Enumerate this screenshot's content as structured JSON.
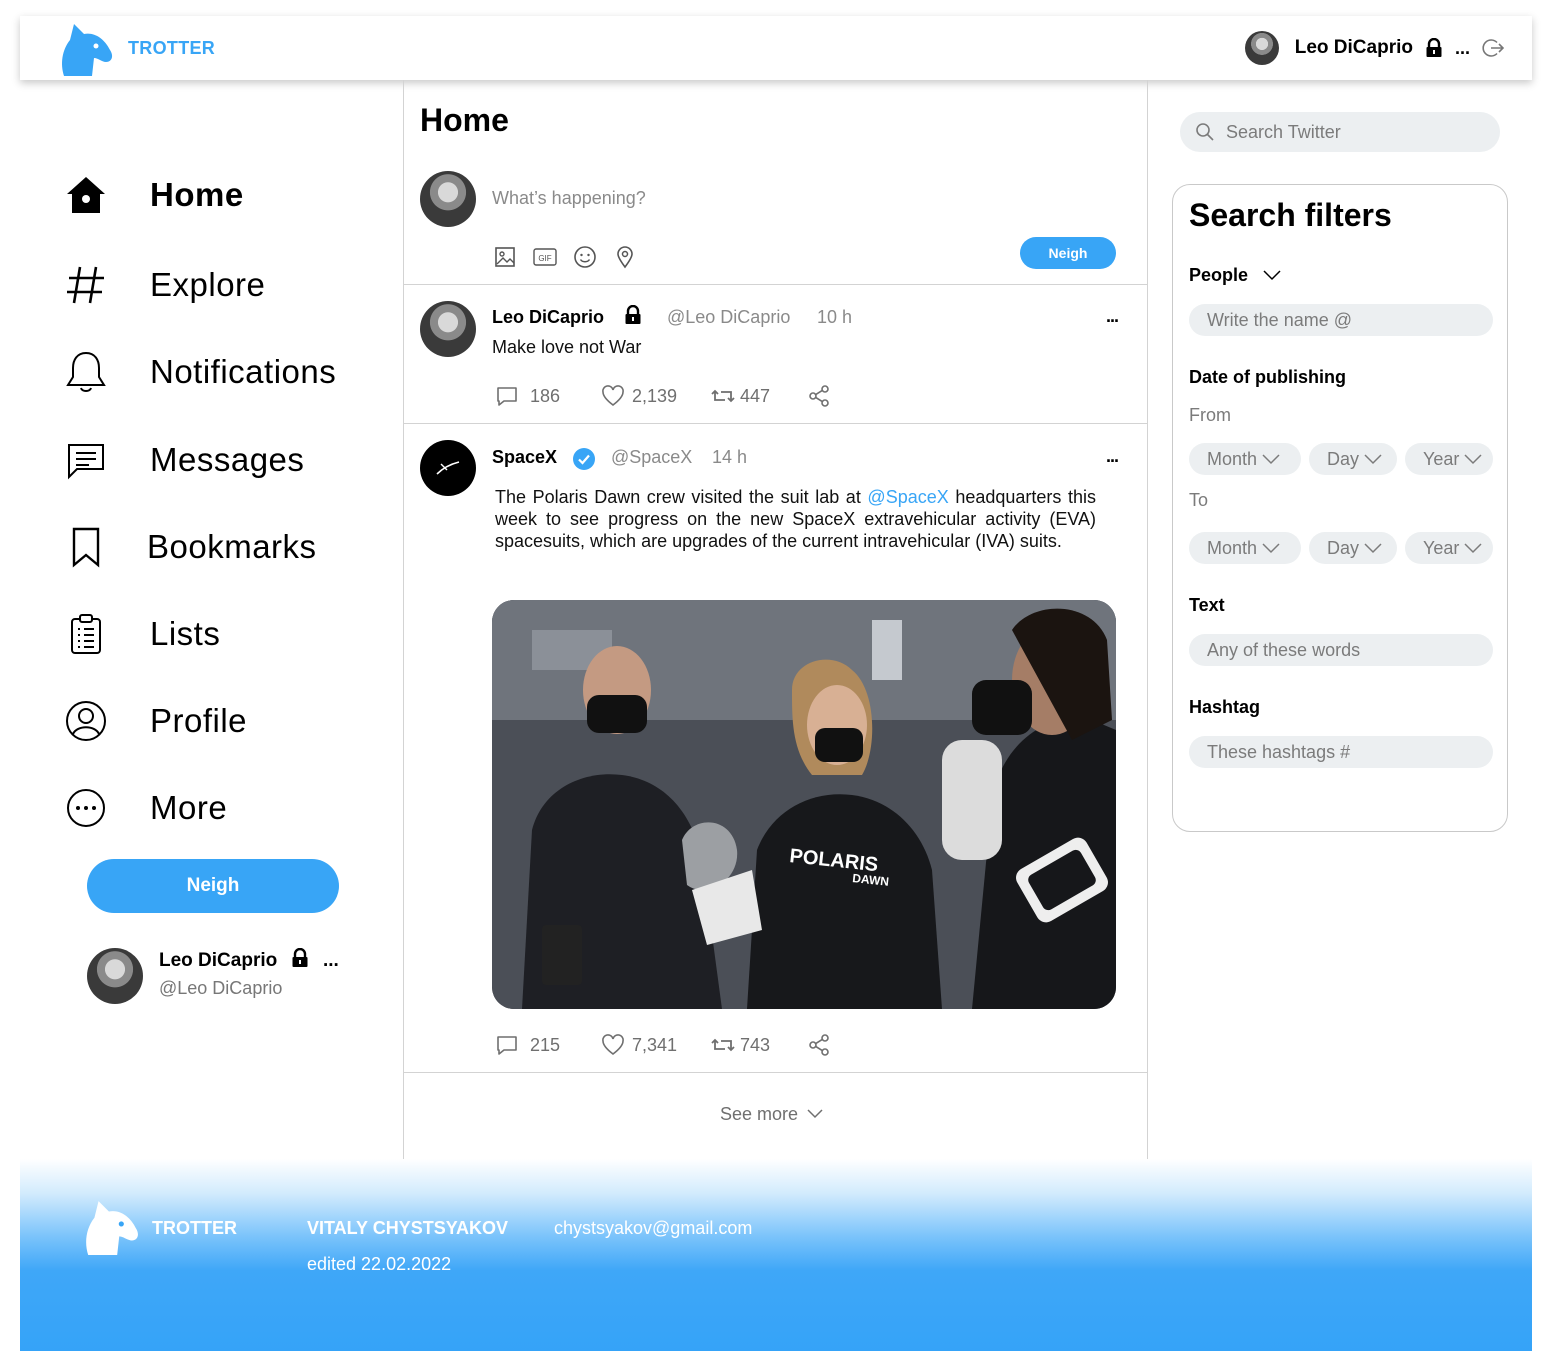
{
  "app": {
    "name": "TROTTER",
    "accent": "#38a5f6"
  },
  "header": {
    "user_name": "Leo DiCaprio",
    "more": "..."
  },
  "nav": {
    "items": [
      {
        "label": "Home",
        "icon": "home-icon"
      },
      {
        "label": "Explore",
        "icon": "hashtag-icon"
      },
      {
        "label": "Notifications",
        "icon": "bell-icon"
      },
      {
        "label": "Messages",
        "icon": "message-icon"
      },
      {
        "label": "Bookmarks",
        "icon": "bookmark-icon"
      },
      {
        "label": "Lists",
        "icon": "clipboard-icon"
      },
      {
        "label": "Profile",
        "icon": "profile-icon"
      },
      {
        "label": "More",
        "icon": "more-circle-icon"
      }
    ],
    "neigh_label": "Neigh",
    "user": {
      "name": "Leo DiCaprio",
      "handle": "@Leo DiCaprio",
      "more": "..."
    }
  },
  "main": {
    "title": "Home",
    "compose": {
      "placeholder": "What’s happening?",
      "button": "Neigh",
      "tools": [
        "image-icon",
        "gif-icon",
        "emoji-icon",
        "location-icon"
      ]
    },
    "tweets": [
      {
        "name": "Leo DiCaprio",
        "handle": "@Leo DiCaprio",
        "time": "10 h",
        "more": "...",
        "text": "Make love not War",
        "replies": "186",
        "likes": "2,139",
        "retweets": "447"
      },
      {
        "name": "SpaceX",
        "handle": "@SpaceX",
        "time": "14 h",
        "more": "...",
        "text_before": "The Polaris Dawn crew visited the suit lab at ",
        "mention": "@SpaceX",
        "text_after": " headquarters this week to see progress on the new SpaceX extravehicular activity (EVA) spacesuits, which are upgrades of the current intravehicular (IVA) suits.",
        "photo_text_1": "POLARIS",
        "photo_text_2": "DAWN",
        "replies": "215",
        "likes": "7,341",
        "retweets": "743"
      }
    ],
    "see_more": "See more"
  },
  "right": {
    "search_placeholder": "Search Twitter",
    "filters": {
      "title": "Search filters",
      "people_label": "People",
      "people_placeholder": "Write the name @",
      "date_label": "Date of publishing",
      "from_label": "From",
      "to_label": "To",
      "month": "Month",
      "day": "Day",
      "year": "Year",
      "text_label": "Text",
      "text_placeholder": "Any of these words",
      "hashtag_label": "Hashtag",
      "hashtag_placeholder": "These hashtags #"
    }
  },
  "footer": {
    "brand": "TROTTER",
    "author": "VITALY CHYSTSYAKOV",
    "email": "chystsyakov@gmail.com",
    "edited": "edited 22.02.2022"
  }
}
